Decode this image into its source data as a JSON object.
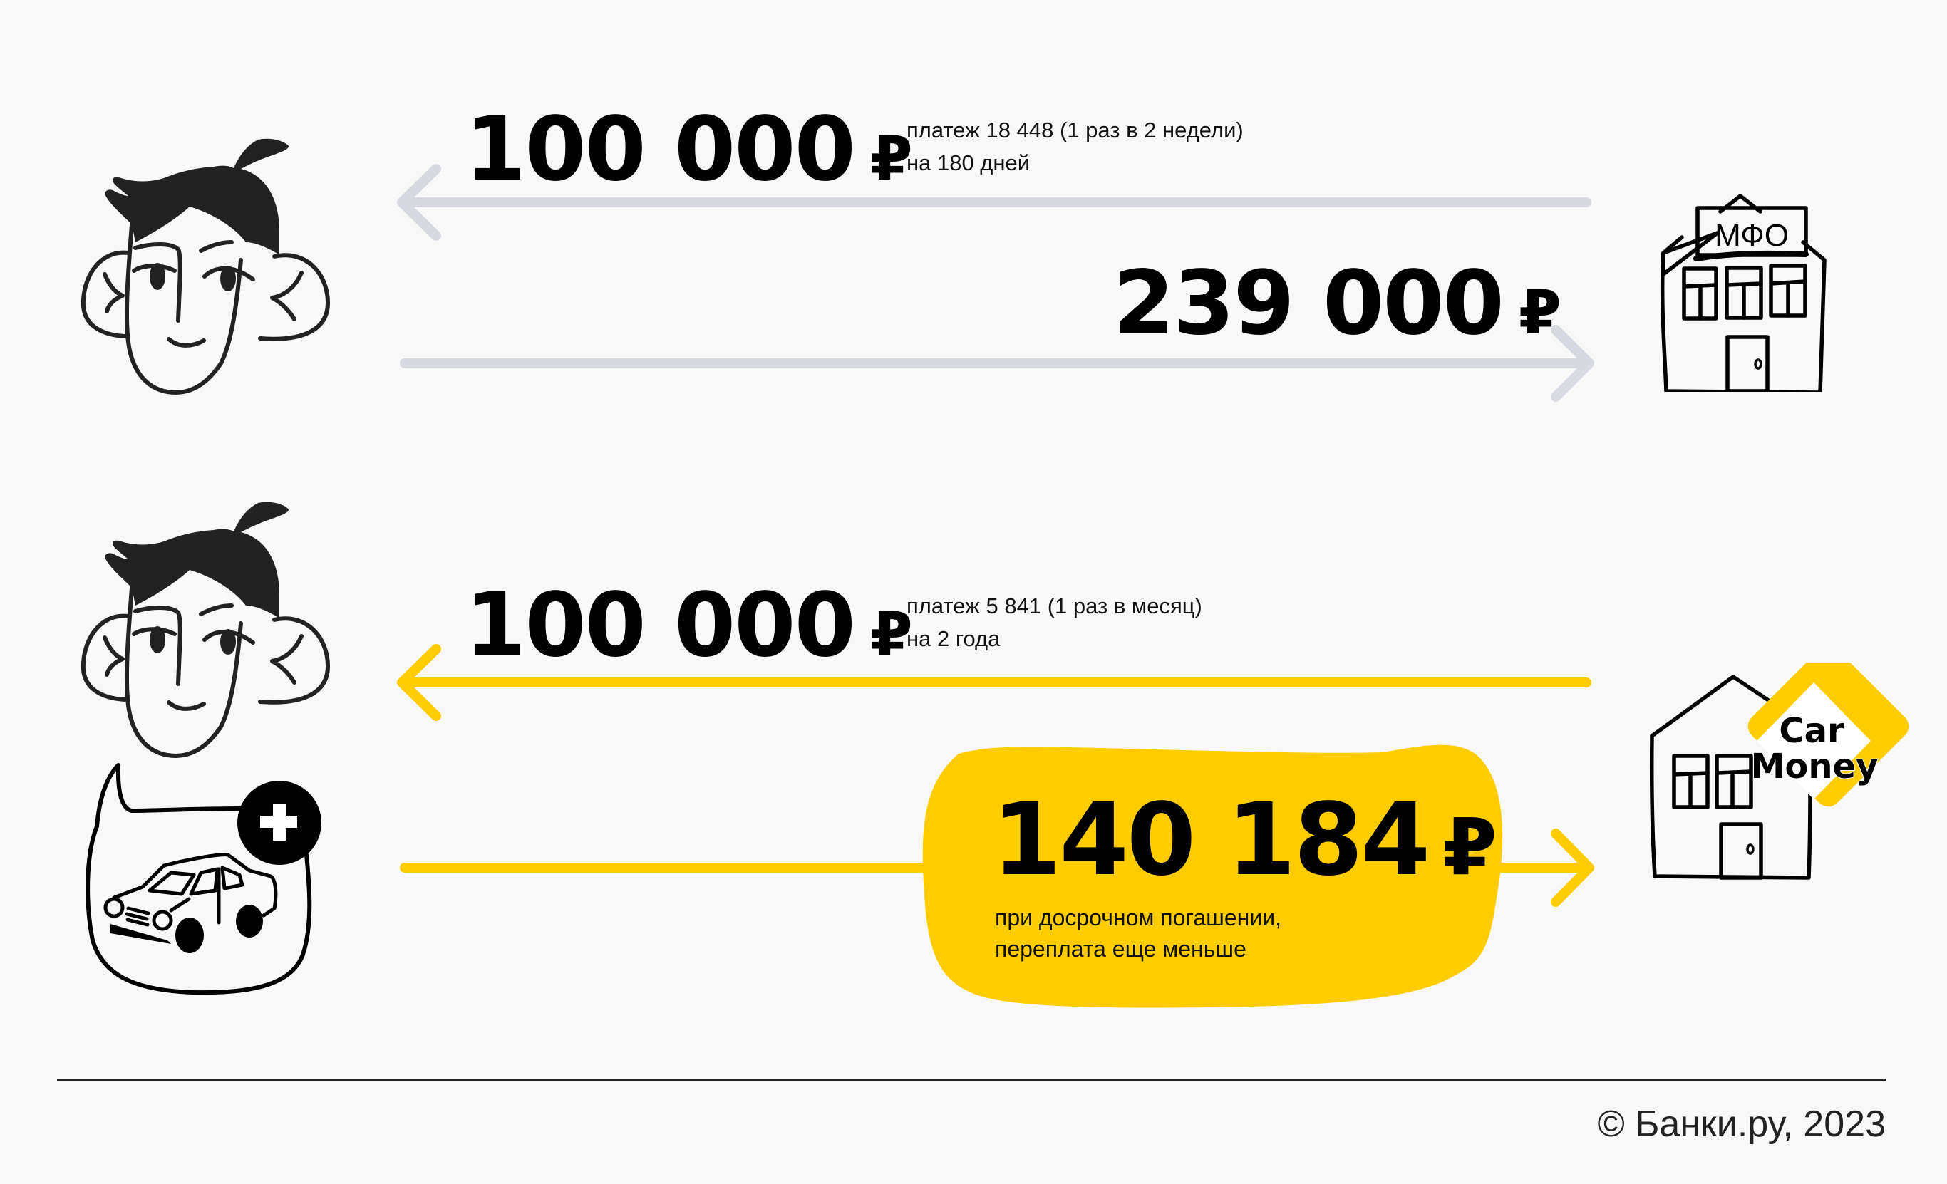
{
  "colors": {
    "background": "#f8f8f8",
    "arrow_gray": "#d6d9e0",
    "accent_yellow": "#ffcc00",
    "ink": "#222222"
  },
  "scenario_mfo": {
    "loan_amount": "100 000",
    "currency": "₽",
    "payment_note_line1": "платеж 18 448 (1 раз в 2 недели)",
    "payment_note_line2": "на 180 дней",
    "repayment_amount": "239 000",
    "lender_sign": "МФО",
    "icons": [
      "person-face-icon",
      "mfo-building-icon",
      "arrow-left-icon",
      "arrow-right-icon"
    ]
  },
  "scenario_carmoney": {
    "loan_amount": "100 000",
    "currency": "₽",
    "payment_note_line1": "платеж 5 841 (1 раз в месяц)",
    "payment_note_line2": "на 2 года",
    "repayment_amount": "140 184",
    "repayment_note_line1": "при досрочном погашении,",
    "repayment_note_line2": "переплата еще меньше",
    "lender_logo_line1": "Car",
    "lender_logo_line2": "Money",
    "icons": [
      "person-face-icon",
      "car-pledge-bubble-icon",
      "plus-icon",
      "carmoney-building-icon",
      "arrow-left-icon",
      "arrow-right-icon"
    ]
  },
  "footer": {
    "copyright": "© Банки.ру, 2023"
  }
}
